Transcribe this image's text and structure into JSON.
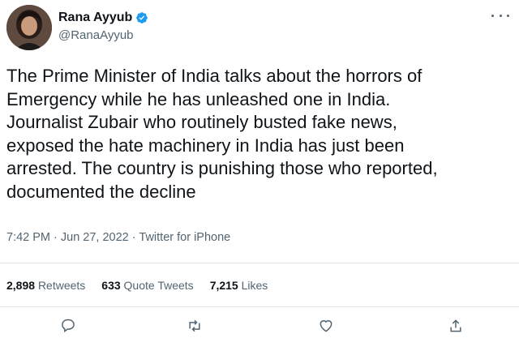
{
  "author": {
    "display_name": "Rana Ayyub",
    "handle": "@RanaAyyub",
    "verified": true
  },
  "tweet": {
    "text": "The Prime Minister of India talks about the horrors of\nEmergency while he has unleashed one in India.\nJournalist Zubair who routinely busted fake news,\nexposed the hate machinery in India has just been\narrested. The country is punishing those who reported,\ndocumented the decline",
    "time": "7:42 PM",
    "date": "Jun 27, 2022",
    "source": "Twitter for iPhone"
  },
  "stats": {
    "retweets_count": "2,898",
    "retweets_label": "Retweets",
    "quotes_count": "633",
    "quotes_label": "Quote Tweets",
    "likes_count": "7,215",
    "likes_label": "Likes"
  },
  "colors": {
    "text": "#0f1419",
    "secondary": "#536471",
    "verified": "#1d9bf0",
    "divider": "#dfe3e6"
  },
  "icons": {
    "reply": "reply-icon",
    "retweet": "retweet-icon",
    "like": "heart-icon",
    "share": "share-icon",
    "more": "more-options-icon",
    "verified": "verified-badge-icon"
  }
}
